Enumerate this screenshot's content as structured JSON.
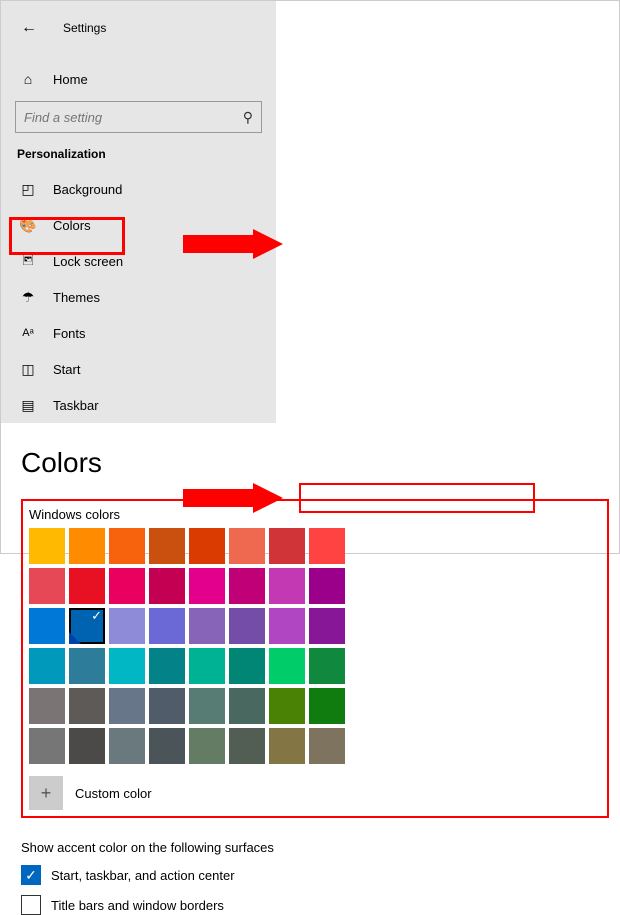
{
  "app": {
    "title": "Settings"
  },
  "home_label": "Home",
  "search": {
    "placeholder": "Find a setting"
  },
  "section_label": "Personalization",
  "sidebar": {
    "items": [
      {
        "label": "Background"
      },
      {
        "label": "Colors"
      },
      {
        "label": "Lock screen"
      },
      {
        "label": "Themes"
      },
      {
        "label": "Fonts"
      },
      {
        "label": "Start"
      },
      {
        "label": "Taskbar"
      }
    ]
  },
  "page_heading": "Colors",
  "windows_colors_label": "Windows colors",
  "custom_color_label": "Custom color",
  "accent_surfaces_label": "Show accent color on the following surfaces",
  "surfaces": [
    {
      "label": "Start, taskbar, and action center",
      "checked": true
    },
    {
      "label": "Title bars and window borders",
      "checked": false
    }
  ],
  "colors": [
    [
      "#ffb900",
      "#ff8c00",
      "#f7630c",
      "#ca5010",
      "#da3b01",
      "#ef6950",
      "#d13438",
      "#ff4343"
    ],
    [
      "#e74856",
      "#e81123",
      "#ea005e",
      "#c30052",
      "#e3008c",
      "#bf0077",
      "#c239b3",
      "#9a0089"
    ],
    [
      "#0078d7",
      "#0063b1",
      "#8e8cd8",
      "#6b69d6",
      "#8764b8",
      "#744da9",
      "#b146c2",
      "#881798"
    ],
    [
      "#0099bc",
      "#2d7d9a",
      "#00b7c3",
      "#038387",
      "#00b294",
      "#018574",
      "#00cc6a",
      "#10893e"
    ],
    [
      "#7a7574",
      "#5d5a58",
      "#68768a",
      "#515c6b",
      "#567c73",
      "#486860",
      "#498205",
      "#107c10"
    ],
    [
      "#767676",
      "#4c4a48",
      "#69797e",
      "#4a5459",
      "#647c64",
      "#525e54",
      "#847545",
      "#7e735f"
    ]
  ],
  "selected_color": {
    "row": 2,
    "col": 1
  }
}
